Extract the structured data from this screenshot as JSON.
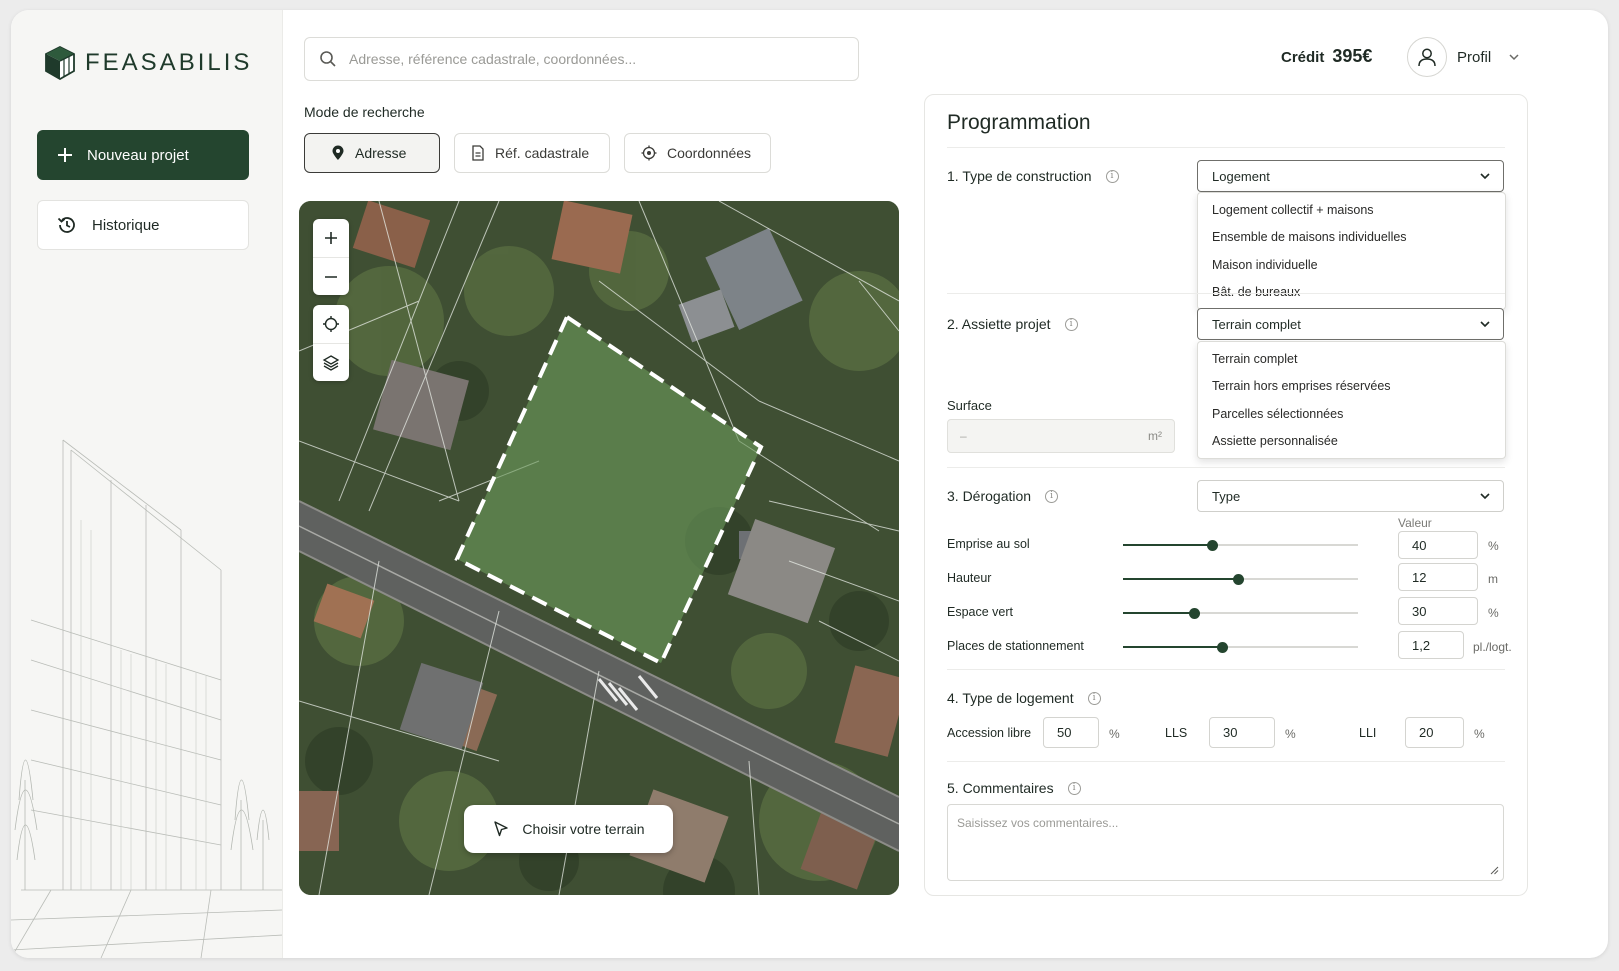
{
  "brand": {
    "name": "FEASABILIS"
  },
  "sidebar": {
    "new_project": "Nouveau projet",
    "history": "Historique"
  },
  "header": {
    "search_placeholder": "Adresse, référence cadastrale, coordonnées...",
    "credit_label": "Crédit",
    "credit_value": "395€",
    "profile_label": "Profil"
  },
  "search_mode": {
    "label": "Mode de recherche",
    "options": [
      "Adresse",
      "Réf. cadastrale",
      "Coordonnées"
    ],
    "active": "Adresse"
  },
  "map": {
    "choose_button": "Choisir votre terrain",
    "zoom_in": "+",
    "zoom_out": "−"
  },
  "panel": {
    "title": "Programmation",
    "construction": {
      "label": "1. Type de construction",
      "selected": "Logement",
      "options": [
        "Logement collectif + maisons",
        "Ensemble de maisons individuelles",
        "Maison individuelle",
        "Bât. de bureaux"
      ]
    },
    "assiette": {
      "label": "2. Assiette projet",
      "selected": "Terrain complet",
      "options": [
        "Terrain complet",
        "Terrain hors emprises réservées",
        "Parcelles sélectionnées",
        "Assiette personnalisée"
      ]
    },
    "surface": {
      "label": "Surface",
      "value": "–",
      "unit": "m²"
    },
    "derogation": {
      "label": "3. Dérogation",
      "selected": "Type",
      "value_header": "Valeur",
      "rows": [
        {
          "label": "Emprise au sol",
          "value": "40",
          "unit": "%",
          "level": 0.38
        },
        {
          "label": "Hauteur",
          "value": "12",
          "unit": "m",
          "level": 0.49
        },
        {
          "label": "Espace vert",
          "value": "30",
          "unit": "%",
          "level": 0.3
        },
        {
          "label": "Places de stationnement",
          "value": "1,2",
          "unit": "pl./logt.",
          "level": 0.42
        }
      ]
    },
    "logement": {
      "label": "4. Type de logement",
      "accession_label": "Accession libre",
      "accession_value": "50",
      "accession_unit": "%",
      "lls_label": "LLS",
      "lls_value": "30",
      "lls_unit": "%",
      "lli_label": "LLI",
      "lli_value": "20",
      "lli_unit": "%"
    },
    "commentaires": {
      "label": "5. Commentaires",
      "placeholder": "Saisissez vos commentaires..."
    }
  },
  "colors": {
    "brand_green": "#24452f",
    "selection_fill": "#5f8f4e",
    "background": "#ececec"
  },
  "icons": [
    "logo-icon",
    "plus-icon",
    "history-icon",
    "search-icon",
    "pin-icon",
    "document-icon",
    "target-icon",
    "user-icon",
    "chevron-down-icon",
    "crosshair-icon",
    "layers-icon",
    "cursor-icon",
    "info-icon"
  ]
}
